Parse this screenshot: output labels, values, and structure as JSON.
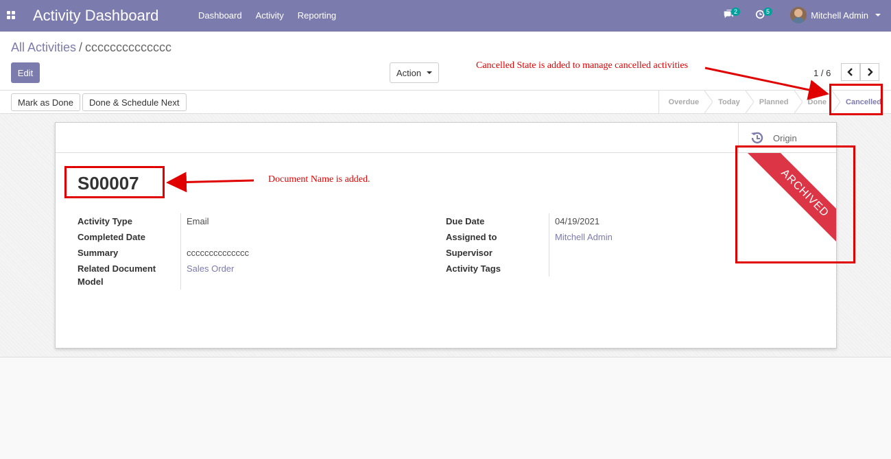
{
  "navbar": {
    "brand": "Activity Dashboard",
    "menu": [
      "Dashboard",
      "Activity",
      "Reporting"
    ],
    "messages_count": "2",
    "activities_count": "5",
    "user_name": "Mitchell Admin"
  },
  "breadcrumb": {
    "parent": "All Activities",
    "separator": "/",
    "current": "cccccccccccccc"
  },
  "buttons": {
    "edit": "Edit",
    "action": "Action",
    "mark_done": "Mark as Done",
    "done_schedule": "Done & Schedule Next"
  },
  "pager": {
    "value": "1 / 6"
  },
  "stages": [
    {
      "label": "Overdue",
      "active": false
    },
    {
      "label": "Today",
      "active": false
    },
    {
      "label": "Planned",
      "active": false
    },
    {
      "label": "Done",
      "active": false
    },
    {
      "label": "Cancelled",
      "active": true
    }
  ],
  "sheet": {
    "origin_label": "Origin",
    "doc_name": "S00007",
    "ribbon": "ARCHIVED",
    "left_fields": [
      {
        "label": "Activity Type",
        "value": "Email",
        "link": false
      },
      {
        "label": "Completed Date",
        "value": "",
        "link": false
      },
      {
        "label": "Summary",
        "value": "cccccccccccccc",
        "link": false
      },
      {
        "label": "Related Document Model",
        "value": "Sales Order",
        "link": true
      }
    ],
    "right_fields": [
      {
        "label": "Due Date",
        "value": "04/19/2021",
        "link": false
      },
      {
        "label": "Assigned to",
        "value": "Mitchell Admin",
        "link": true
      },
      {
        "label": "Supervisor",
        "value": "",
        "link": false
      },
      {
        "label": "Activity Tags",
        "value": "",
        "link": false
      }
    ]
  },
  "annotations": {
    "cancelled_note": "Cancelled State is added to manage cancelled activities",
    "docname_note": "Document Name is added."
  },
  "colors": {
    "brand": "#7c7bad",
    "badge": "#00a09d",
    "ribbon": "#dc3545",
    "annotation": "#e00000"
  }
}
